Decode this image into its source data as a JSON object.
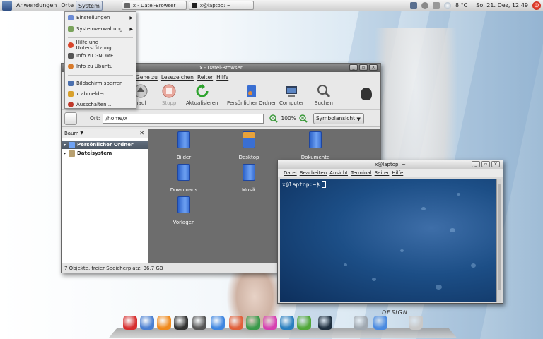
{
  "top_panel": {
    "menus": [
      "Anwendungen",
      "Orte",
      "System"
    ],
    "tasks": [
      {
        "label": "x - Datei-Browser"
      },
      {
        "label": "x@laptop: ~"
      }
    ],
    "weather": "8 °C",
    "clock": "So, 21. Dez, 12:49"
  },
  "system_menu": {
    "items": [
      {
        "label": "Einstellungen",
        "submenu": true,
        "color": "#6b8bd6"
      },
      {
        "label": "Systemverwaltung",
        "submenu": true,
        "color": "#7aa35c"
      },
      {
        "label": "Hilfe und Unterstützung",
        "submenu": false,
        "color": "#d8452b"
      },
      {
        "label": "Info zu GNOME",
        "submenu": false,
        "color": "#555555"
      },
      {
        "label": "Info zu Ubuntu",
        "submenu": false,
        "color": "#d87a2b"
      },
      {
        "label": "Bildschirm sperren",
        "submenu": false,
        "color": "#4a6fae"
      },
      {
        "label": "x abmelden …",
        "submenu": false,
        "color": "#d8a02b"
      },
      {
        "label": "Ausschalten …",
        "submenu": false,
        "color": "#c0392b"
      }
    ]
  },
  "file_browser": {
    "title": "x - Datei-Browser",
    "menubar": [
      "Gehe zu",
      "Lesezeichen",
      "Reiter",
      "Hilfe"
    ],
    "toolbar": [
      {
        "label": "nauf",
        "icon": "up-arrow-icon",
        "disabled": false
      },
      {
        "label": "Stopp",
        "icon": "stop-icon",
        "disabled": true
      },
      {
        "label": "Aktualisieren",
        "icon": "refresh-icon",
        "disabled": false
      },
      {
        "label": "Persönlicher Ordner",
        "icon": "home-folder-icon",
        "disabled": false
      },
      {
        "label": "Computer",
        "icon": "computer-icon",
        "disabled": false
      },
      {
        "label": "Suchen",
        "icon": "search-icon",
        "disabled": false
      }
    ],
    "location": {
      "label": "Ort:",
      "value": "/home/x"
    },
    "zoom": "100%",
    "view_mode": "Symbolansicht",
    "sidebar": {
      "header": "Baum",
      "tree": [
        {
          "label": "Persönlicher Ordner",
          "selected": true
        },
        {
          "label": "Dateisystem",
          "selected": false
        }
      ]
    },
    "items": [
      {
        "label": "Bilder",
        "icon": "folder-icon"
      },
      {
        "label": "Desktop",
        "icon": "desktop-icon"
      },
      {
        "label": "Dokumente",
        "icon": "folder-icon"
      },
      {
        "label": "Downloads",
        "icon": "folder-icon"
      },
      {
        "label": "Musik",
        "icon": "folder-icon"
      },
      {
        "label": "Vorlagen",
        "icon": "folder-icon"
      }
    ],
    "status": "7 Objekte, freier Speicherplatz: 36,7 GB"
  },
  "terminal": {
    "title": "x@laptop: ~",
    "menubar": [
      "Datei",
      "Bearbeiten",
      "Ansicht",
      "Terminal",
      "Reiter",
      "Hilfe"
    ],
    "prompt": "x@laptop:~$"
  },
  "dock": {
    "label": "DESIGN",
    "items": [
      {
        "icon": "browser-icon",
        "color": "#d62e2e"
      },
      {
        "icon": "image-viewer-icon",
        "color": "#4a7fd1"
      },
      {
        "icon": "vlc-icon",
        "color": "#f08a1c"
      },
      {
        "icon": "audio-player-icon",
        "color": "#333333"
      },
      {
        "icon": "headphones-icon",
        "color": "#555555"
      },
      {
        "icon": "messenger-icon",
        "color": "#3f86e0"
      },
      {
        "icon": "firefox-icon",
        "color": "#e0603a"
      },
      {
        "icon": "settings-icon",
        "color": "#3a9a4a"
      },
      {
        "icon": "color-picker-icon",
        "color": "#d640b0"
      },
      {
        "icon": "web-icon",
        "color": "#2a7fbf"
      },
      {
        "icon": "network-icon",
        "color": "#52a83a"
      },
      {
        "icon": "terminal-icon",
        "color": "#1f2f3f"
      },
      {
        "icon": "shield-icon",
        "color": "#a0a8b0"
      },
      {
        "icon": "finder-icon",
        "color": "#4a8ae0"
      },
      {
        "icon": "trash-icon",
        "color": "#c8c8c8"
      }
    ]
  }
}
